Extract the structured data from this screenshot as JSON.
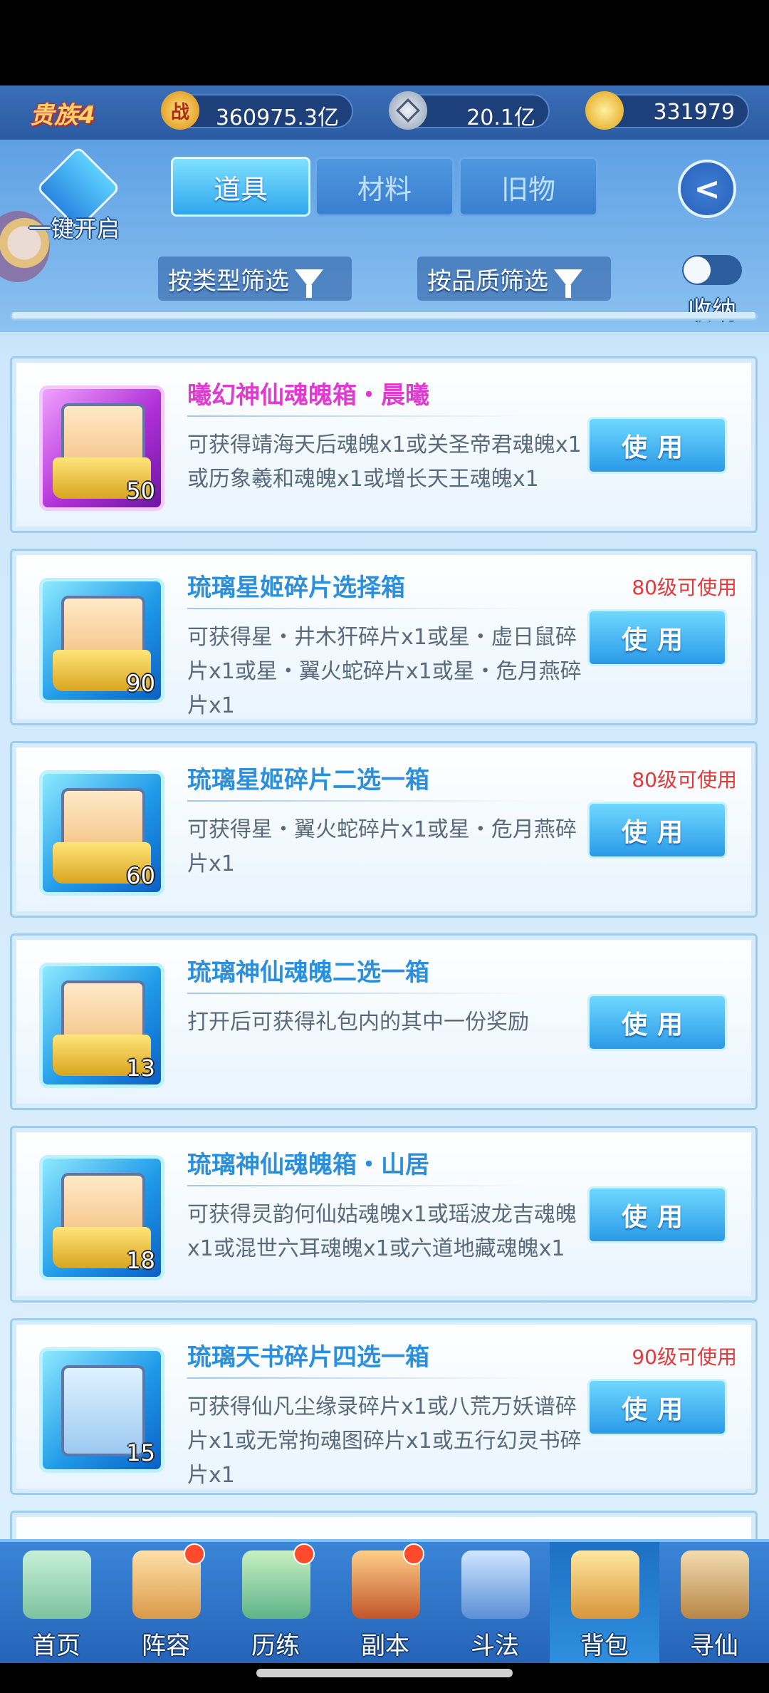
{
  "resources": {
    "vip": "贵族4",
    "power_icon": "战",
    "power": "360975.3亿",
    "silver": "20.1亿",
    "gold": "331979"
  },
  "header": {
    "one_key_open": "一键开启",
    "tabs": [
      {
        "label": "道具",
        "active": true
      },
      {
        "label": "材料",
        "active": false
      },
      {
        "label": "旧物",
        "active": false
      }
    ],
    "filter_type": "按类型筛选",
    "filter_quality": "按品质筛选",
    "collapse_label": "收纳"
  },
  "items": [
    {
      "title": "曦幻神仙魂魄箱・晨曦",
      "desc": "可获得靖海天后魂魄x1或关圣帝君魂魄x1或历象羲和魂魄x1或增长天王魂魄x1",
      "qty": "50",
      "level": "",
      "use": "使用",
      "rarity": "purple"
    },
    {
      "title": "琉璃星姬碎片选择箱",
      "desc": "可获得星・井木犴碎片x1或星・虚日鼠碎片x1或星・翼火蛇碎片x1或星・危月燕碎片x1",
      "qty": "90",
      "level": "80级可使用",
      "use": "使用",
      "rarity": "blue"
    },
    {
      "title": "琉璃星姬碎片二选一箱",
      "desc": "可获得星・翼火蛇碎片x1或星・危月燕碎片x1",
      "qty": "60",
      "level": "80级可使用",
      "use": "使用",
      "rarity": "blue"
    },
    {
      "title": "琉璃神仙魂魄二选一箱",
      "desc": "打开后可获得礼包内的其中一份奖励",
      "qty": "13",
      "level": "",
      "use": "使用",
      "rarity": "blue"
    },
    {
      "title": "琉璃神仙魂魄箱・山居",
      "desc": "可获得灵韵何仙姑魂魄x1或瑶波龙吉魂魄x1或混世六耳魂魄x1或六道地藏魂魄x1",
      "qty": "18",
      "level": "",
      "use": "使用",
      "rarity": "blue"
    },
    {
      "title": "琉璃天书碎片四选一箱",
      "desc": "可获得仙凡尘缘录碎片x1或八荒万妖谱碎片x1或无常拘魂图碎片x1或五行幻灵书碎片x1",
      "qty": "15",
      "level": "90级可使用",
      "use": "使用",
      "rarity": "blue"
    }
  ],
  "nav": [
    {
      "label": "首页",
      "badge": false,
      "icon": "home-icon"
    },
    {
      "label": "阵容",
      "badge": true,
      "icon": "lineup-icon"
    },
    {
      "label": "历练",
      "badge": true,
      "icon": "training-icon"
    },
    {
      "label": "副本",
      "badge": true,
      "icon": "dungeon-icon"
    },
    {
      "label": "斗法",
      "badge": false,
      "icon": "battle-icon"
    },
    {
      "label": "背包",
      "badge": false,
      "icon": "bag-icon",
      "active": true
    },
    {
      "label": "寻仙",
      "badge": false,
      "icon": "seek-icon"
    }
  ]
}
